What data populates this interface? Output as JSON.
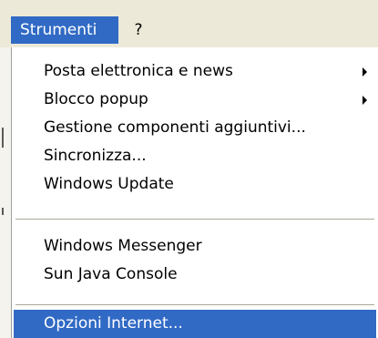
{
  "menubar": {
    "items": [
      {
        "label": "Strumenti"
      },
      {
        "label": "?"
      }
    ]
  },
  "dropdown": {
    "items": [
      {
        "label": "Posta elettronica e news",
        "submenu": true
      },
      {
        "label": "Blocco popup",
        "submenu": true
      },
      {
        "label": "Gestione componenti aggiuntivi..."
      },
      {
        "label": "Sincronizza..."
      },
      {
        "label": "Windows Update"
      },
      {
        "label": "Windows Messenger"
      },
      {
        "label": "Sun Java Console"
      },
      {
        "label": "Opzioni Internet...",
        "highlighted": true
      }
    ]
  },
  "colors": {
    "highlight": "#316ac5",
    "menubar_bg": "#ece9d8"
  }
}
